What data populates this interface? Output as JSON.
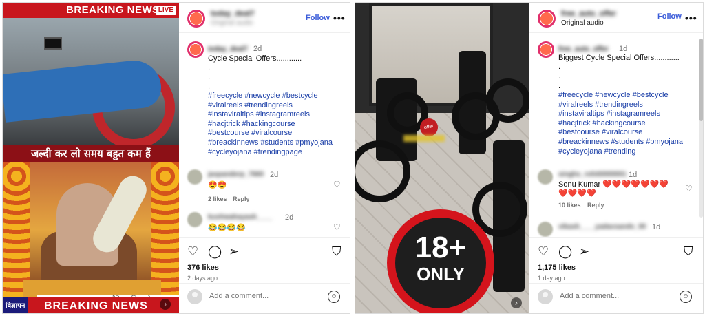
{
  "left_post": {
    "media": {
      "top_banner": "BREAKING NEWS",
      "live_badge": "LIVE",
      "hindi_banner": "जल्दी कर लो समय बहुत कम हैं",
      "bottom_banner": "BREAKING NEWS",
      "ad_label": "विज्ञापन",
      "ticker_text": "राजनीति सामाजिक सरोकार"
    },
    "header": {
      "username": "today_deal7",
      "subline": "Original audio",
      "follow_label": "Follow",
      "more": "•••"
    },
    "caption": {
      "username": "today_deal7",
      "time": "2d",
      "title": "Cycle Special Offers............",
      "dots": [
        ".",
        ".",
        "."
      ],
      "hashtags": [
        "#freecycle #newcycle #bestcycle",
        "#viralreels #trendingreels",
        "#instaviraltips #instagramreels",
        "#hacjtrick #hackingcourse",
        "#bestcourse #viralcourse",
        "#breackinnews #students #pmyojana",
        "#cycleyojana #trendingpage"
      ]
    },
    "comments": [
      {
        "username": "jaspanderp_7660",
        "time": "2d",
        "text": "😍😍",
        "likes": "2 likes",
        "reply": "Reply"
      },
      {
        "username": "kushwahayash____",
        "time": "2d",
        "text": "😂😂😂😂"
      }
    ],
    "actions": {
      "likes": "376 likes",
      "date": "2 days ago"
    },
    "add_comment_placeholder": "Add a comment...",
    "icons": [
      "heart-icon",
      "comment-icon",
      "share-icon",
      "bookmark-icon",
      "emoji-icon"
    ]
  },
  "right_post": {
    "media": {
      "badge_main": "18+",
      "badge_sub": "ONLY",
      "offer_tag": "offer"
    },
    "header": {
      "username": "free_auto_offer",
      "subline": "Original audio",
      "follow_label": "Follow",
      "more": "•••"
    },
    "caption": {
      "username": "free_auto_offer",
      "time": "1d",
      "title": "Biggest Cycle Special Offers............",
      "dots": [
        ".",
        ".",
        "."
      ],
      "hashtags": [
        "#freecycle #newcycle #bestcycle",
        "#viralreels #trendingreels",
        "#instaviraltips #instagramreels",
        "#hacjtrick #hackingcourse",
        "#bestcourse #viralcourse",
        "#breackinnews #students #pmyojana",
        "#cycleyojana #trending"
      ]
    },
    "comments": [
      {
        "username": "singhs_rohit0000001",
        "time": "1d",
        "text": "Sonu Kumar ❤️❤️❤️❤️❤️❤️❤️❤️❤️❤️❤️",
        "likes": "10 likes",
        "reply": "Reply"
      },
      {
        "username": "vikash____yadavsandv_00",
        "time": "1d",
        "text": ""
      }
    ],
    "actions": {
      "likes": "1,175 likes",
      "date": "1 day ago"
    },
    "add_comment_placeholder": "Add a comment...",
    "icons": [
      "heart-icon",
      "comment-icon",
      "share-icon",
      "bookmark-icon",
      "emoji-icon"
    ]
  }
}
